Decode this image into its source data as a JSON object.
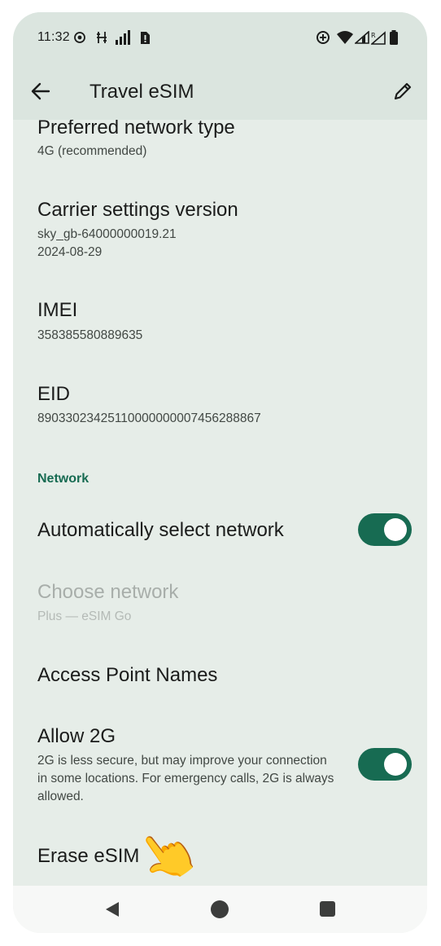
{
  "status_bar": {
    "time": "11:32",
    "icons": [
      "location-target-icon",
      "settings-sync-icon",
      "signal-bars-icon",
      "sim-alert-icon",
      "data-saver-icon",
      "wifi-icon",
      "signal-icon",
      "roaming-signal-icon",
      "battery-icon"
    ]
  },
  "app_bar": {
    "title": "Travel eSIM",
    "icons": [
      "back-arrow-icon",
      "edit-pencil-icon"
    ]
  },
  "settings": {
    "preferred_network": {
      "title": "Preferred network type",
      "subtitle": "4G (recommended)"
    },
    "carrier_settings": {
      "title": "Carrier settings version",
      "line1": "sky_gb-64000000019.21",
      "line2": "2024-08-29"
    },
    "imei": {
      "title": "IMEI",
      "value": "358385580889635"
    },
    "eid": {
      "title": "EID",
      "value": "89033023425110000000007456288867"
    },
    "network_header": "Network",
    "auto_select": {
      "title": "Automatically select network",
      "enabled": true
    },
    "choose_network": {
      "title": "Choose network",
      "subtitle": "Plus — eSIM Go",
      "disabled": true
    },
    "apn": {
      "title": "Access Point Names"
    },
    "allow_2g": {
      "title": "Allow 2G",
      "subtitle": "2G is less secure, but may improve your connection in some locations. For emergency calls, 2G is always allowed.",
      "enabled": true
    },
    "erase": {
      "title": "Erase eSIM"
    }
  },
  "colors": {
    "accent": "#176b52",
    "background": "#e6ede8",
    "header": "#dbe5df"
  },
  "nav_bar": {
    "icons": [
      "nav-back-icon",
      "nav-home-icon",
      "nav-recents-icon"
    ]
  },
  "overlay": {
    "pointer": "👆"
  }
}
